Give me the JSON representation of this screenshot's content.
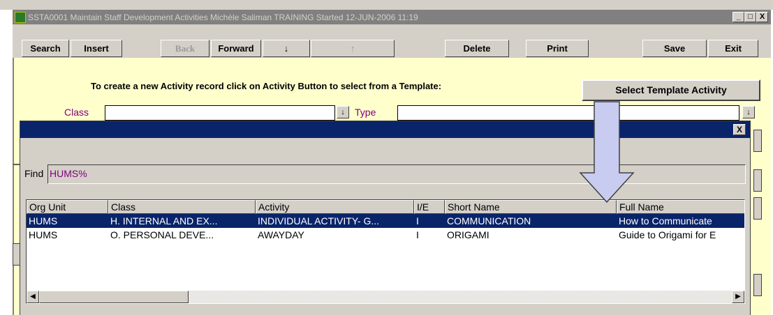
{
  "window": {
    "title": "SSTA0001 Maintain Staff Development Activities  Michèle Saliman TRAINING  Started 12-JUN-2006 11:19",
    "minimize": "_",
    "maximize": "□",
    "close": "X"
  },
  "toolbar": {
    "search": "Search",
    "insert": "Insert",
    "back": "Back",
    "forward": "Forward",
    "down": "↓",
    "up": "↑",
    "delete": "Delete",
    "print": "Print",
    "save": "Save",
    "exit": "Exit"
  },
  "form": {
    "instruction": "To create a new Activity record click on Activity Button to select from a Template:",
    "select_template_button": "Select Template Activity",
    "class_label": "Class",
    "type_label": "Type",
    "class_value": "",
    "type_value": ""
  },
  "dialog": {
    "close": "X",
    "find_label": "Find",
    "find_value": "HUMS%",
    "columns": [
      "Org Unit",
      "Class",
      "Activity",
      "I/E",
      "Short Name",
      "Full Name"
    ],
    "rows": [
      [
        "HUMS",
        "H. INTERNAL AND EX...",
        "INDIVIDUAL ACTIVITY- G...",
        "I",
        "COMMUNICATION",
        "How to Communicate"
      ],
      [
        "HUMS",
        "O. PERSONAL DEVE...",
        "AWAYDAY",
        "I",
        "ORIGAMI",
        "Guide to Origami for E"
      ]
    ],
    "selected_row": 0
  },
  "colors": {
    "selection": "#0a246a",
    "form_background": "#ffffcc",
    "label": "#800080",
    "arrow_fill": "#c8ccf0",
    "arrow_stroke": "#404040"
  },
  "icons": {
    "app": "app-icon",
    "annotation": "down-arrow-annotation"
  }
}
